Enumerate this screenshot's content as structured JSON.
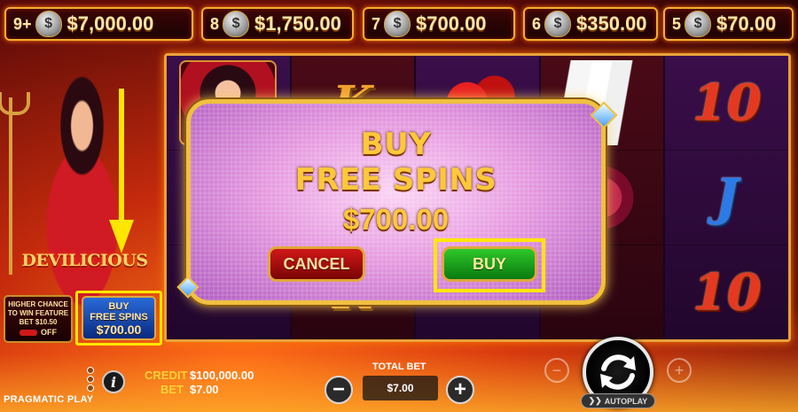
{
  "jackpots": [
    {
      "count": "9+",
      "amount": "$7,000.00"
    },
    {
      "count": "8",
      "amount": "$1,750.00"
    },
    {
      "count": "7",
      "amount": "$700.00"
    },
    {
      "count": "6",
      "amount": "$350.00"
    },
    {
      "count": "5",
      "amount": "$70.00"
    }
  ],
  "jackpot_bag_glyph": "$",
  "logo": "DEVILICIOUS",
  "reels": [
    [
      "devil",
      "",
      ""
    ],
    [
      "K",
      "",
      "K"
    ],
    [
      "dice",
      "",
      ""
    ],
    [
      "cards",
      "rose",
      ""
    ],
    [
      "10",
      "J",
      "10"
    ]
  ],
  "feature_bet": {
    "line1": "HIGHER CHANCE",
    "line2": "TO WIN FEATURE",
    "line3": "BET $10.50",
    "state": "OFF"
  },
  "buy_free_spins_button": {
    "line1": "BUY",
    "line2": "FREE SPINS",
    "amount": "$700.00"
  },
  "modal": {
    "title_line1": "BUY",
    "title_line2": "FREE SPINS",
    "price": "$700.00",
    "cancel_label": "CANCEL",
    "buy_label": "BUY"
  },
  "footer": {
    "credit_label": "CREDIT",
    "credit_value": "$100,000.00",
    "bet_label": "BET",
    "bet_value": "$7.00",
    "total_bet_label": "TOTAL BET",
    "total_bet_value": "$7.00",
    "minus_symbol": "−",
    "plus_symbol": "+",
    "info_symbol": "i",
    "autoplay_label": "AUTOPLAY",
    "provider": "PRAGMATIC PLAY"
  },
  "colors": {
    "accent_gold": "#f0c040",
    "highlight_yellow": "#ffe600",
    "buy_green": "#2ec82a",
    "cancel_red": "#d01818"
  }
}
